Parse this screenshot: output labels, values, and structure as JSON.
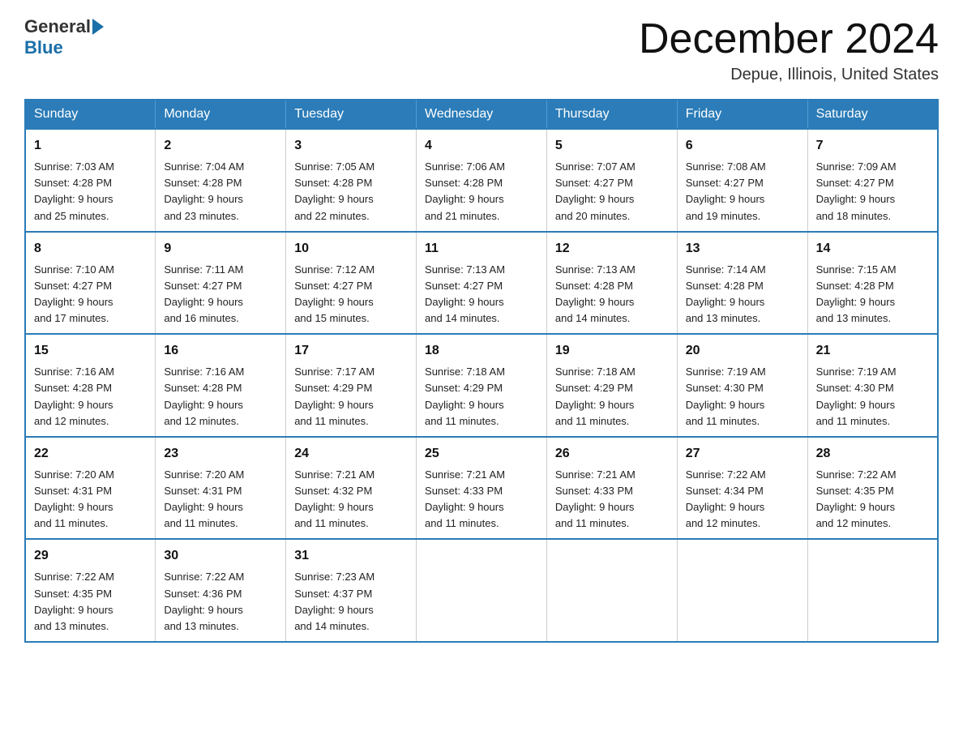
{
  "header": {
    "logo_general": "General",
    "logo_blue": "Blue",
    "month_title": "December 2024",
    "location": "Depue, Illinois, United States"
  },
  "weekdays": [
    "Sunday",
    "Monday",
    "Tuesday",
    "Wednesday",
    "Thursday",
    "Friday",
    "Saturday"
  ],
  "weeks": [
    [
      {
        "day": "1",
        "sunrise": "7:03 AM",
        "sunset": "4:28 PM",
        "daylight": "9 hours and 25 minutes."
      },
      {
        "day": "2",
        "sunrise": "7:04 AM",
        "sunset": "4:28 PM",
        "daylight": "9 hours and 23 minutes."
      },
      {
        "day": "3",
        "sunrise": "7:05 AM",
        "sunset": "4:28 PM",
        "daylight": "9 hours and 22 minutes."
      },
      {
        "day": "4",
        "sunrise": "7:06 AM",
        "sunset": "4:28 PM",
        "daylight": "9 hours and 21 minutes."
      },
      {
        "day": "5",
        "sunrise": "7:07 AM",
        "sunset": "4:27 PM",
        "daylight": "9 hours and 20 minutes."
      },
      {
        "day": "6",
        "sunrise": "7:08 AM",
        "sunset": "4:27 PM",
        "daylight": "9 hours and 19 minutes."
      },
      {
        "day": "7",
        "sunrise": "7:09 AM",
        "sunset": "4:27 PM",
        "daylight": "9 hours and 18 minutes."
      }
    ],
    [
      {
        "day": "8",
        "sunrise": "7:10 AM",
        "sunset": "4:27 PM",
        "daylight": "9 hours and 17 minutes."
      },
      {
        "day": "9",
        "sunrise": "7:11 AM",
        "sunset": "4:27 PM",
        "daylight": "9 hours and 16 minutes."
      },
      {
        "day": "10",
        "sunrise": "7:12 AM",
        "sunset": "4:27 PM",
        "daylight": "9 hours and 15 minutes."
      },
      {
        "day": "11",
        "sunrise": "7:13 AM",
        "sunset": "4:27 PM",
        "daylight": "9 hours and 14 minutes."
      },
      {
        "day": "12",
        "sunrise": "7:13 AM",
        "sunset": "4:28 PM",
        "daylight": "9 hours and 14 minutes."
      },
      {
        "day": "13",
        "sunrise": "7:14 AM",
        "sunset": "4:28 PM",
        "daylight": "9 hours and 13 minutes."
      },
      {
        "day": "14",
        "sunrise": "7:15 AM",
        "sunset": "4:28 PM",
        "daylight": "9 hours and 13 minutes."
      }
    ],
    [
      {
        "day": "15",
        "sunrise": "7:16 AM",
        "sunset": "4:28 PM",
        "daylight": "9 hours and 12 minutes."
      },
      {
        "day": "16",
        "sunrise": "7:16 AM",
        "sunset": "4:28 PM",
        "daylight": "9 hours and 12 minutes."
      },
      {
        "day": "17",
        "sunrise": "7:17 AM",
        "sunset": "4:29 PM",
        "daylight": "9 hours and 11 minutes."
      },
      {
        "day": "18",
        "sunrise": "7:18 AM",
        "sunset": "4:29 PM",
        "daylight": "9 hours and 11 minutes."
      },
      {
        "day": "19",
        "sunrise": "7:18 AM",
        "sunset": "4:29 PM",
        "daylight": "9 hours and 11 minutes."
      },
      {
        "day": "20",
        "sunrise": "7:19 AM",
        "sunset": "4:30 PM",
        "daylight": "9 hours and 11 minutes."
      },
      {
        "day": "21",
        "sunrise": "7:19 AM",
        "sunset": "4:30 PM",
        "daylight": "9 hours and 11 minutes."
      }
    ],
    [
      {
        "day": "22",
        "sunrise": "7:20 AM",
        "sunset": "4:31 PM",
        "daylight": "9 hours and 11 minutes."
      },
      {
        "day": "23",
        "sunrise": "7:20 AM",
        "sunset": "4:31 PM",
        "daylight": "9 hours and 11 minutes."
      },
      {
        "day": "24",
        "sunrise": "7:21 AM",
        "sunset": "4:32 PM",
        "daylight": "9 hours and 11 minutes."
      },
      {
        "day": "25",
        "sunrise": "7:21 AM",
        "sunset": "4:33 PM",
        "daylight": "9 hours and 11 minutes."
      },
      {
        "day": "26",
        "sunrise": "7:21 AM",
        "sunset": "4:33 PM",
        "daylight": "9 hours and 11 minutes."
      },
      {
        "day": "27",
        "sunrise": "7:22 AM",
        "sunset": "4:34 PM",
        "daylight": "9 hours and 12 minutes."
      },
      {
        "day": "28",
        "sunrise": "7:22 AM",
        "sunset": "4:35 PM",
        "daylight": "9 hours and 12 minutes."
      }
    ],
    [
      {
        "day": "29",
        "sunrise": "7:22 AM",
        "sunset": "4:35 PM",
        "daylight": "9 hours and 13 minutes."
      },
      {
        "day": "30",
        "sunrise": "7:22 AM",
        "sunset": "4:36 PM",
        "daylight": "9 hours and 13 minutes."
      },
      {
        "day": "31",
        "sunrise": "7:23 AM",
        "sunset": "4:37 PM",
        "daylight": "9 hours and 14 minutes."
      },
      null,
      null,
      null,
      null
    ]
  ],
  "labels": {
    "sunrise": "Sunrise:",
    "sunset": "Sunset:",
    "daylight": "Daylight:"
  }
}
